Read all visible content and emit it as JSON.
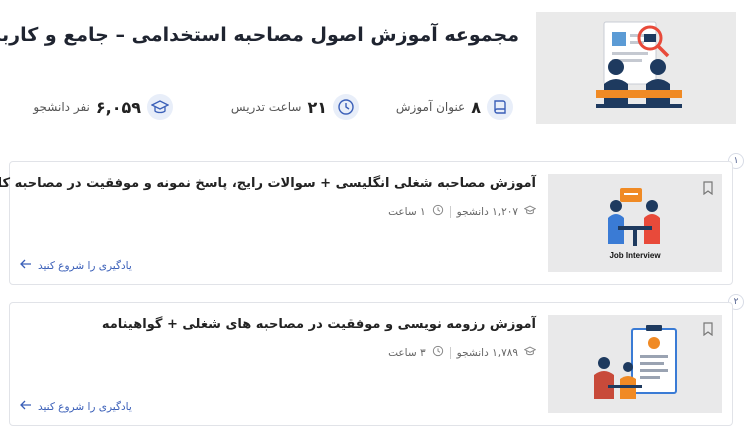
{
  "course": {
    "title": "مجموعه آموزش اصول مصاحبه استخدامی – جامع و کاربردی",
    "stats": {
      "lessons": {
        "value": "۸",
        "label": "عنوان آموزش",
        "icon": "book-icon"
      },
      "hours": {
        "value": "۲۱",
        "label": "ساعت تدریس",
        "icon": "clock-icon"
      },
      "students": {
        "value": "۶,۰۵۹",
        "label": "نفر دانشجو",
        "icon": "graduation-cap-icon"
      }
    }
  },
  "items": [
    {
      "number": "۱",
      "title": "آموزش مصاحبه شغلی انگلیسی + سوالات رایج، پاسخ نمونه و موفقیت در مصاحبه کاری",
      "students": "۱,۲۰۷ دانشجو",
      "duration": "۱ ساعت",
      "thumb_caption": "Job Interview",
      "start_label": "یادگیری را شروع کنید"
    },
    {
      "number": "۲",
      "title": "آموزش رزومه نویسی و موفقیت در مصاحبه های شغلی + گواهینامه",
      "students": "۱,۷۸۹ دانشجو",
      "duration": "۳ ساعت",
      "thumb_caption": "",
      "start_label": "یادگیری را شروع کنید"
    }
  ],
  "colors": {
    "accent": "#3a5fb8",
    "navy": "#1e3a5f",
    "orange": "#f08a24",
    "red": "#e84a3a"
  }
}
